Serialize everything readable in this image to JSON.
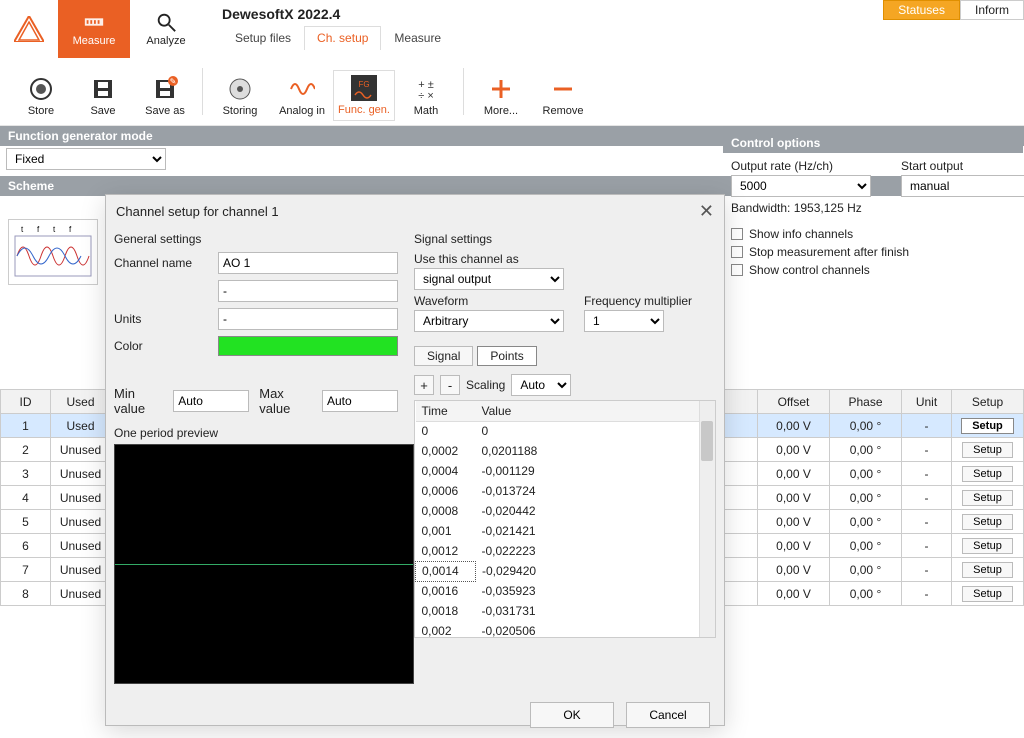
{
  "app": {
    "title": "DewesoftX 2022.4"
  },
  "modes": {
    "measure": "Measure",
    "analyze": "Analyze"
  },
  "subtabs": {
    "setup_files": "Setup files",
    "ch_setup": "Ch. setup",
    "measure": "Measure"
  },
  "top_right": {
    "statuses": "Statuses",
    "inform": "Inform"
  },
  "toolbar": {
    "store": "Store",
    "save": "Save",
    "save_as": "Save as",
    "storing": "Storing",
    "analog_in": "Analog in",
    "func_gen": "Func. gen.",
    "math": "Math",
    "more": "More...",
    "remove": "Remove"
  },
  "fg_mode": {
    "title": "Function generator mode",
    "value": "Fixed"
  },
  "scheme": {
    "title": "Scheme"
  },
  "control": {
    "title": "Control options",
    "output_rate_label": "Output rate (Hz/ch)",
    "output_rate_value": "5000",
    "start_output_label": "Start output",
    "start_output_value": "manual",
    "bandwidth": "Bandwidth: 1953,125 Hz",
    "checks": {
      "show_info": "Show info channels",
      "stop_after": "Stop measurement after finish",
      "show_control": "Show control channels"
    }
  },
  "grid": {
    "headers": {
      "id": "ID",
      "used": "Used",
      "offset": "Offset",
      "phase": "Phase",
      "unit": "Unit",
      "setup": "Setup"
    },
    "setup_btn": "Setup",
    "rows": [
      {
        "id": "1",
        "used": "Used",
        "offset": "0,00 V",
        "phase": "0,00 °",
        "unit": "-"
      },
      {
        "id": "2",
        "used": "Unused",
        "offset": "0,00 V",
        "phase": "0,00 °",
        "unit": "-"
      },
      {
        "id": "3",
        "used": "Unused",
        "offset": "0,00 V",
        "phase": "0,00 °",
        "unit": "-"
      },
      {
        "id": "4",
        "used": "Unused",
        "offset": "0,00 V",
        "phase": "0,00 °",
        "unit": "-"
      },
      {
        "id": "5",
        "used": "Unused",
        "offset": "0,00 V",
        "phase": "0,00 °",
        "unit": "-"
      },
      {
        "id": "6",
        "used": "Unused",
        "offset": "0,00 V",
        "phase": "0,00 °",
        "unit": "-"
      },
      {
        "id": "7",
        "used": "Unused",
        "offset": "0,00 V",
        "phase": "0,00 °",
        "unit": "-"
      },
      {
        "id": "8",
        "used": "Unused",
        "offset": "0,00 V",
        "phase": "0,00 °",
        "unit": "-"
      }
    ]
  },
  "dialog": {
    "title": "Channel setup for channel 1",
    "general": {
      "header": "General settings",
      "channel_name_label": "Channel name",
      "channel_name": "AO 1",
      "desc": "-",
      "units_label": "Units",
      "units": "-",
      "color_label": "Color",
      "min_label": "Min value",
      "min": "Auto",
      "max_label": "Max value",
      "max": "Auto",
      "preview_label": "One period preview"
    },
    "signal": {
      "header": "Signal settings",
      "use_as_label": "Use this channel as",
      "use_as": "signal output",
      "waveform_label": "Waveform",
      "waveform": "Arbitrary",
      "freq_mult_label": "Frequency multiplier",
      "freq_mult": "1",
      "tab_signal": "Signal",
      "tab_points": "Points",
      "plus": "+",
      "minus": "-",
      "scaling_label": "Scaling",
      "scaling": "Auto",
      "col_time": "Time",
      "col_value": "Value",
      "points": [
        {
          "t": "0",
          "v": "0"
        },
        {
          "t": "0,0002",
          "v": "0,0201188"
        },
        {
          "t": "0,0004",
          "v": "-0,001129"
        },
        {
          "t": "0,0006",
          "v": "-0,013724"
        },
        {
          "t": "0,0008",
          "v": "-0,020442"
        },
        {
          "t": "0,001",
          "v": "-0,021421"
        },
        {
          "t": "0,0012",
          "v": "-0,022223"
        },
        {
          "t": "0,0014",
          "v": "-0,029420"
        },
        {
          "t": "0,0016",
          "v": "-0,035923"
        },
        {
          "t": "0,0018",
          "v": "-0,031731"
        },
        {
          "t": "0,002",
          "v": "-0,020506"
        }
      ]
    },
    "ok": "OK",
    "cancel": "Cancel"
  }
}
